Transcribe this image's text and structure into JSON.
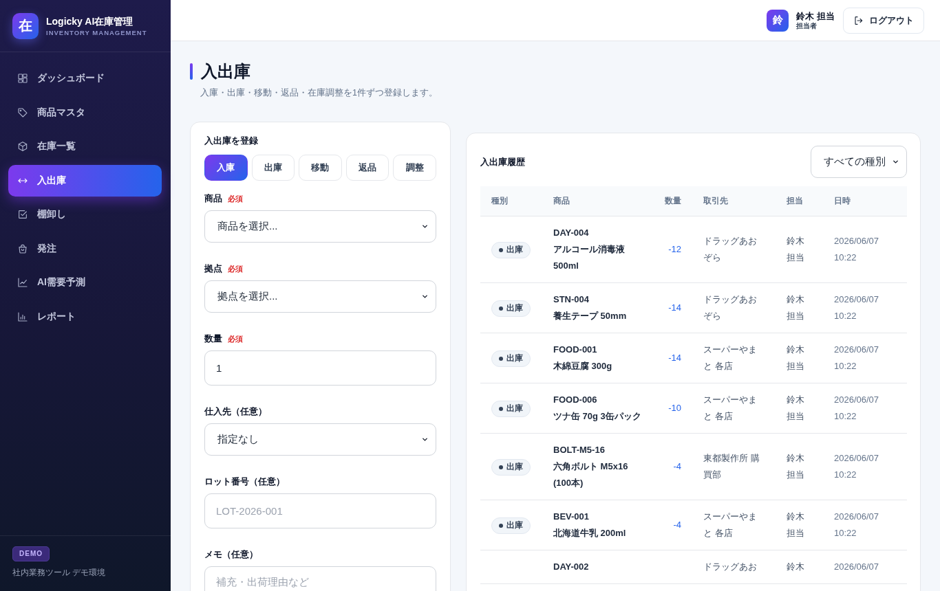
{
  "sidebar": {
    "logo": {
      "mark": "在",
      "title": "Logicky AI在庫管理",
      "subtitle": "INVENTORY MANAGEMENT"
    },
    "items": [
      {
        "label": "ダッシュボード",
        "selected": false
      },
      {
        "label": "商品マスタ",
        "selected": false
      },
      {
        "label": "在庫一覧",
        "selected": false
      },
      {
        "label": "入出庫",
        "selected": true
      },
      {
        "label": "棚卸し",
        "selected": false
      },
      {
        "label": "発注",
        "selected": false
      },
      {
        "label": "AI需要予測",
        "selected": false
      },
      {
        "label": "レポート",
        "selected": false
      }
    ],
    "footer": {
      "badge": "DEMO",
      "note": "社内業務ツール デモ環境"
    }
  },
  "topbar": {
    "user": {
      "avatar": "鈴",
      "name": "鈴木 担当",
      "role": "担当者"
    },
    "logout": "ログアウト"
  },
  "page": {
    "title": "入出庫",
    "subtitle": "入庫・出庫・移動・返品・在庫調整を1件ずつ登録します。"
  },
  "form": {
    "title": "入出庫を登録",
    "types": [
      {
        "label": "入庫",
        "selected": true
      },
      {
        "label": "出庫",
        "selected": false
      },
      {
        "label": "移動",
        "selected": false
      },
      {
        "label": "返品",
        "selected": false
      },
      {
        "label": "調整",
        "selected": false
      }
    ],
    "fields": [
      {
        "kind": "select",
        "label": "商品",
        "required": "必須",
        "value": "商品を選択..."
      },
      {
        "kind": "select",
        "label": "拠点",
        "required": "必須",
        "value": "拠点を選択..."
      },
      {
        "kind": "input",
        "label": "数量",
        "required": "必須",
        "value": "1"
      },
      {
        "kind": "select",
        "label": "仕入先（任意）",
        "value": "指定なし"
      },
      {
        "kind": "input",
        "label": "ロット番号（任意）",
        "placeholder": "LOT-2026-001"
      },
      {
        "kind": "textarea",
        "label": "メモ（任意）",
        "placeholder": "補充・出荷理由など"
      }
    ]
  },
  "history": {
    "title": "入出庫履歴",
    "filter": "すべての種別",
    "columns": [
      "種別",
      "商品",
      "数量",
      "取引先",
      "担当",
      "日時"
    ],
    "rows": [
      {
        "type": "出庫",
        "code": "DAY-004",
        "name": "アルコール消毒液 500ml",
        "qty": "-12",
        "partner": "ドラッグあおぞら",
        "staff": "鈴木担当",
        "datetime": "2026/06/07 10:22"
      },
      {
        "type": "出庫",
        "code": "STN-004",
        "name": "養生テープ 50mm",
        "qty": "-14",
        "partner": "ドラッグあおぞら",
        "staff": "鈴木担当",
        "datetime": "2026/06/07 10:22"
      },
      {
        "type": "出庫",
        "code": "FOOD-001",
        "name": "木綿豆腐 300g",
        "qty": "-14",
        "partner": "スーパーやまと 各店",
        "staff": "鈴木担当",
        "datetime": "2026/06/07 10:22"
      },
      {
        "type": "出庫",
        "code": "FOOD-006",
        "name": "ツナ缶 70g 3缶パック",
        "qty": "-10",
        "partner": "スーパーやまと 各店",
        "staff": "鈴木担当",
        "datetime": "2026/06/07 10:22"
      },
      {
        "type": "出庫",
        "code": "BOLT-M5-16",
        "name": "六角ボルト M5x16 (100本)",
        "qty": "-4",
        "partner": "東都製作所 購買部",
        "staff": "鈴木担当",
        "datetime": "2026/06/07 10:22"
      },
      {
        "type": "出庫",
        "code": "BEV-001",
        "name": "北海道牛乳 200ml",
        "qty": "-4",
        "partner": "スーパーやまと 各店",
        "staff": "鈴木担当",
        "datetime": "2026/06/07 10:22"
      },
      {
        "code": "DAY-002",
        "partner": "ドラッグあお",
        "staff": "鈴木",
        "datetime": "2026/06/07"
      }
    ]
  }
}
